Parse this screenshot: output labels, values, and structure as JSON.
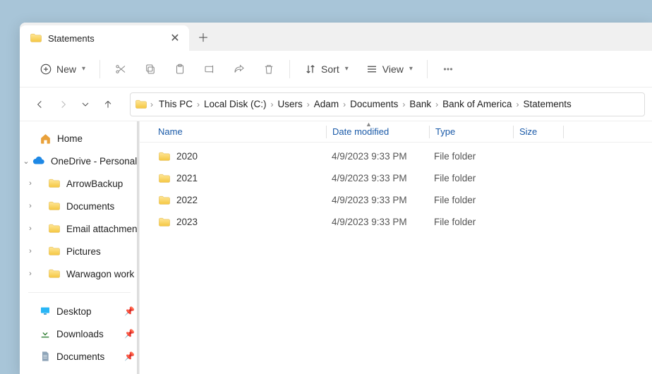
{
  "tab": {
    "title": "Statements"
  },
  "toolbar": {
    "new": "New",
    "sort": "Sort",
    "view": "View"
  },
  "breadcrumbs": [
    "This PC",
    "Local Disk (C:)",
    "Users",
    "Adam",
    "Documents",
    "Bank",
    "Bank of America",
    "Statements"
  ],
  "sidebar": {
    "home": "Home",
    "onedrive": "OneDrive - Personal",
    "items": [
      "ArrowBackup",
      "Documents",
      "Email attachments",
      "Pictures",
      "Warwagon work"
    ],
    "quick": [
      {
        "label": "Desktop",
        "pin": true,
        "icon": "desktop"
      },
      {
        "label": "Downloads",
        "pin": true,
        "icon": "downloads"
      },
      {
        "label": "Documents",
        "pin": true,
        "icon": "document"
      }
    ]
  },
  "columns": {
    "name": "Name",
    "date": "Date modified",
    "type": "Type",
    "size": "Size"
  },
  "rows": [
    {
      "name": "2020",
      "date": "4/9/2023 9:33 PM",
      "type": "File folder",
      "size": ""
    },
    {
      "name": "2021",
      "date": "4/9/2023 9:33 PM",
      "type": "File folder",
      "size": ""
    },
    {
      "name": "2022",
      "date": "4/9/2023 9:33 PM",
      "type": "File folder",
      "size": ""
    },
    {
      "name": "2023",
      "date": "4/9/2023 9:33 PM",
      "type": "File folder",
      "size": ""
    }
  ]
}
